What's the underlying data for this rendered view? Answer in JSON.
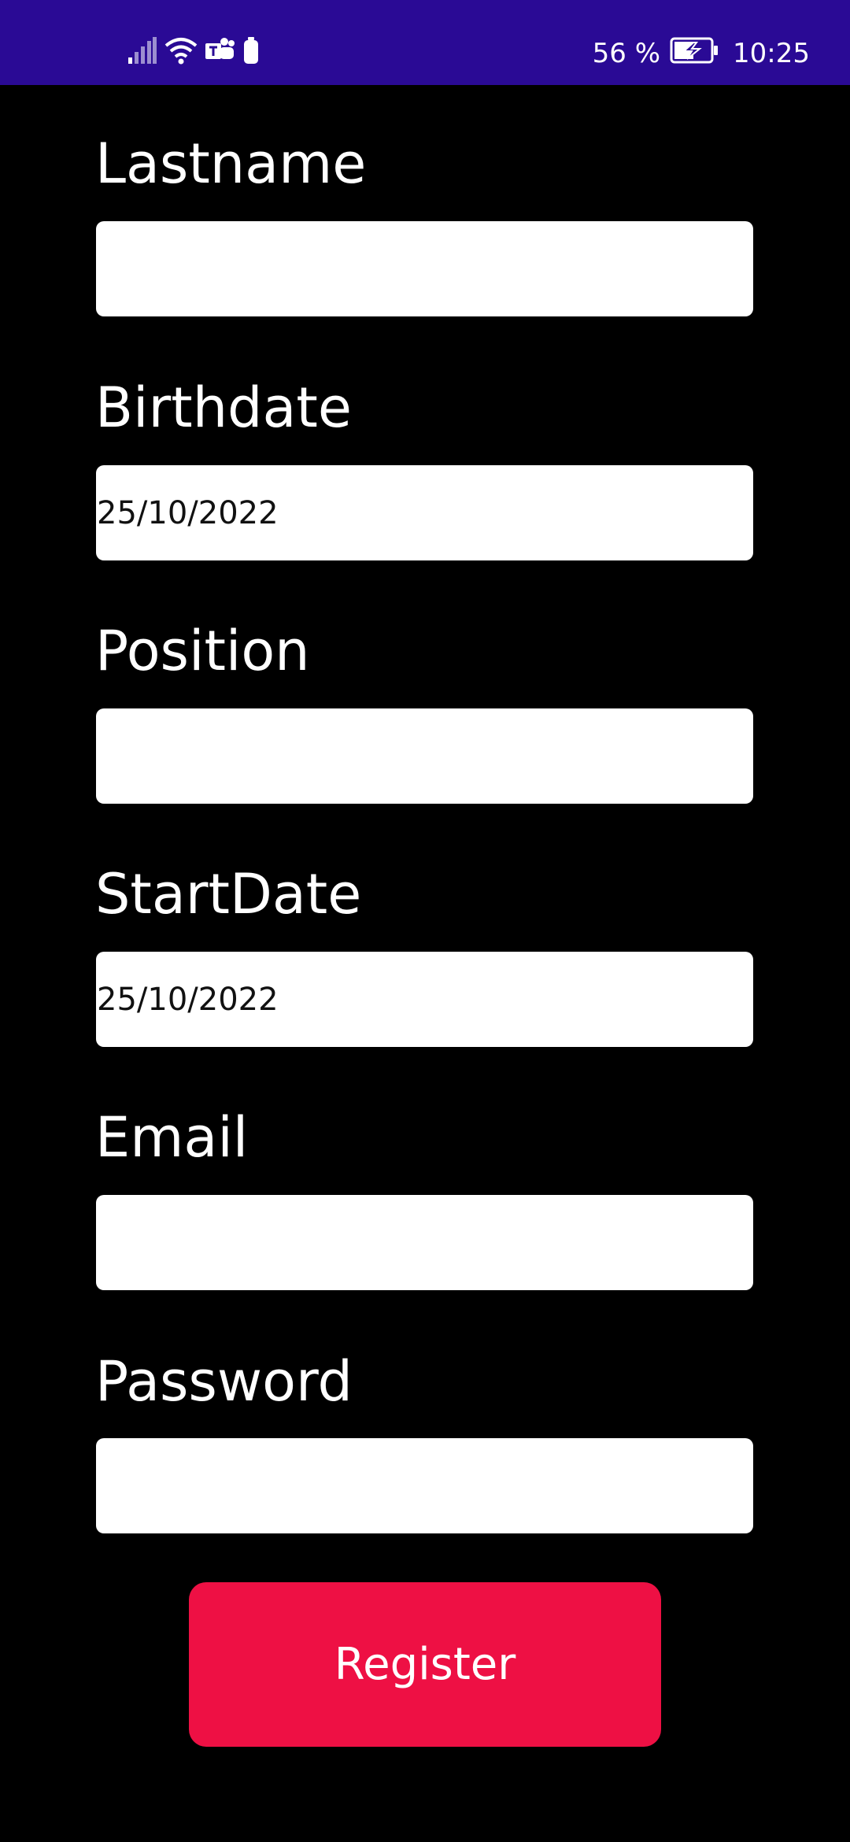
{
  "status_bar": {
    "background": "#2a0a95",
    "icons": [
      "signal-icon",
      "wifi-icon",
      "teams-icon",
      "battery-saver-icon",
      "battery-charging-icon"
    ],
    "battery_percent": "56 %",
    "time": "10:25"
  },
  "form": {
    "fields": [
      {
        "label": "Lastname",
        "value": ""
      },
      {
        "label": "Birthdate",
        "value": "25/10/2022"
      },
      {
        "label": "Position",
        "value": ""
      },
      {
        "label": "StartDate",
        "value": "25/10/2022"
      },
      {
        "label": "Email",
        "value": ""
      },
      {
        "label": "Password",
        "value": ""
      }
    ],
    "submit_label": "Register",
    "submit_color": "#ee1044"
  }
}
